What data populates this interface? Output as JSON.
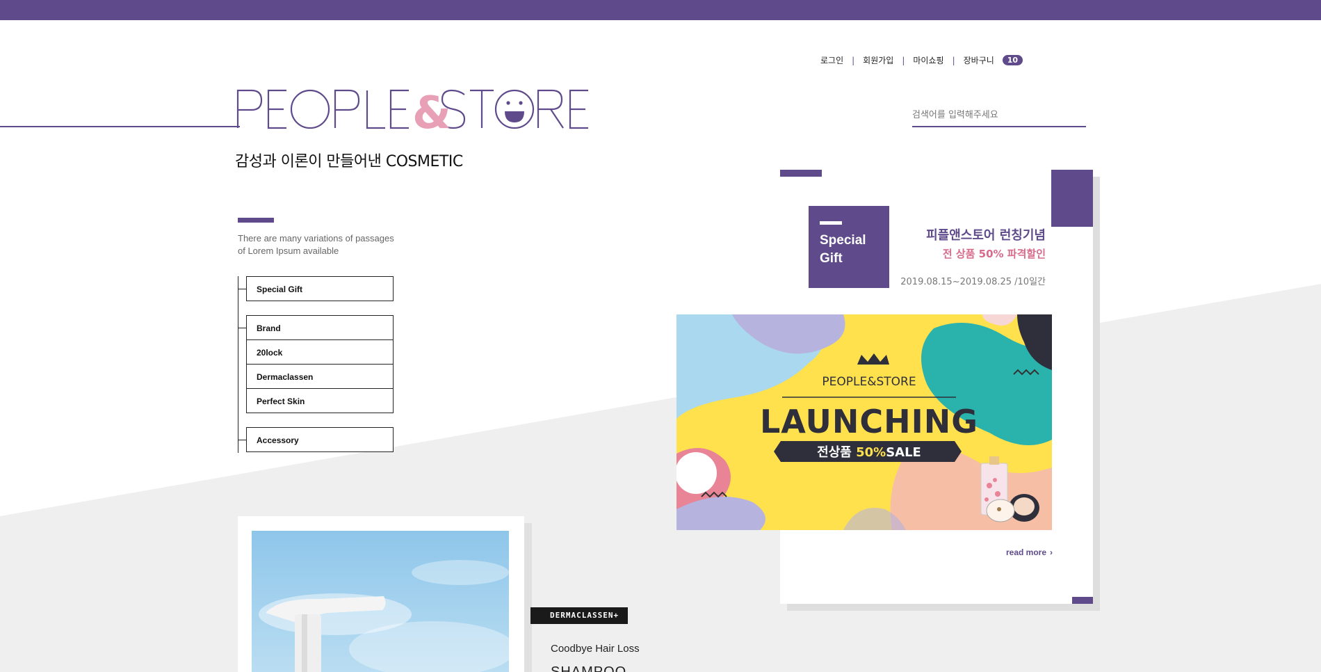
{
  "util_nav": {
    "login": "로그인",
    "signup": "회원가입",
    "mypage": "마이쇼핑",
    "cart": "장바구니",
    "cart_count": "10"
  },
  "logo": {
    "text": "PEOPLE&STORE"
  },
  "tagline": "감성과 이론이 만들어낸 COSMETIC",
  "search": {
    "placeholder": "검색어를 입력해주세요"
  },
  "intro": {
    "line1": "There are many variations of passages",
    "line2": "of Lorem Ipsum available"
  },
  "categories": [
    "Special Gift",
    "Brand",
    "20lock",
    "Dermaclassen",
    "Perfect Skin",
    "Accessory"
  ],
  "product": {
    "brand_tag": "DERMACLASSEN+",
    "subtitle": "Coodbye Hair Loss",
    "title": "SHAMPOO"
  },
  "event": {
    "gift_label": "Special Gift",
    "title": "피플앤스토어 런칭기념",
    "subtitle": "전 상품 50% 파격할인",
    "date": "2019.08.15~2019.08.25 /10일간",
    "read_more": "read more"
  },
  "banner": {
    "brand": "PEOPLE&STORE",
    "headline": "LAUNCHING",
    "sale_prefix": "전상품 ",
    "sale_percent": "50%",
    "sale_suffix": "SALE"
  },
  "colors": {
    "brand_purple": "#5f4b8b",
    "accent_pink": "#d66b8a",
    "banner_yellow": "#ffe14d",
    "banner_teal": "#2ab2ad"
  }
}
